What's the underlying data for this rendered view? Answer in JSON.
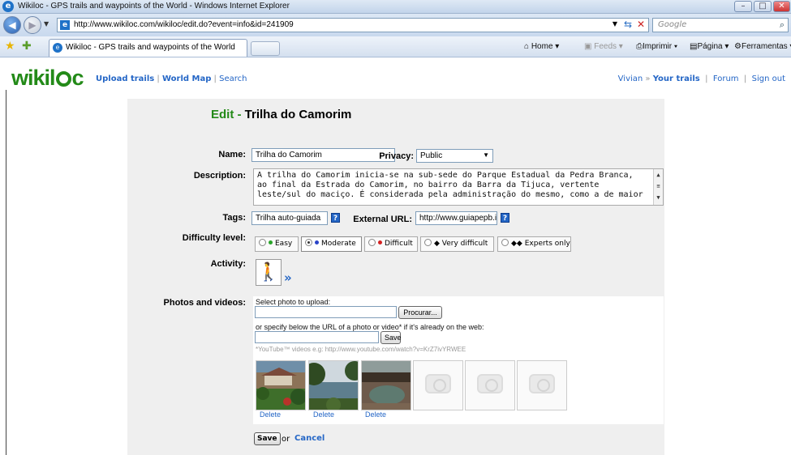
{
  "window": {
    "title": "Wikiloc - GPS trails and waypoints of the World - Windows Internet Explorer"
  },
  "address_bar": {
    "url": "http://www.wikiloc.com/wikiloc/edit.do?event=info&id=241909",
    "search_placeholder": "Google"
  },
  "tabs": [
    {
      "label": "Wikiloc - GPS trails and waypoints of the World"
    }
  ],
  "command_bar": {
    "home": "Home",
    "feeds": "Feeds",
    "print": "Imprimir",
    "page": "Página",
    "tools": "Ferramentas"
  },
  "site_header": {
    "logo": "wikiloc",
    "nav": [
      "Upload trails",
      "World Map",
      "Search"
    ],
    "user": "Vivian",
    "user_links": [
      "Your trails",
      "Forum",
      "Sign out"
    ]
  },
  "form": {
    "heading_prefix": "Edit -",
    "heading_title": "Trilha do Camorim",
    "name_label": "Name:",
    "name_value": "Trilha do Camorim",
    "privacy_label": "Privacy:",
    "privacy_value": "Public",
    "description_label": "Description:",
    "description_lines": [
      "A trilha do Camorim inicia-se na sub-sede do Parque Estadual da Pedra Branca,",
      "ao final da Estrada do Camorim, no bairro da Barra da Tijuca, vertente",
      "leste/sul do maciço. É considerada pela administração do mesmo, como a de maior"
    ],
    "tags_label": "Tags:",
    "tags_value": "Trilha auto-guiada",
    "external_url_label": "External URL:",
    "external_url_value": "http://www.guiapepb.ir",
    "help_glyph": "?",
    "difficulty_label": "Difficulty level:",
    "difficulty_options": [
      {
        "label": "Easy",
        "color": "#2aa52a",
        "selected": false
      },
      {
        "label": "Moderate",
        "color": "#2a44c8",
        "selected": true
      },
      {
        "label": "Difficult",
        "color": "#d42020",
        "selected": false
      },
      {
        "label": "Very difficult",
        "color": "#000000",
        "selected": false
      },
      {
        "label": "Experts only",
        "color": "#000000",
        "selected": false
      }
    ],
    "activity_label": "Activity:",
    "activity_icon": "hiking-icon",
    "activity_more": "»",
    "photos_label": "Photos and videos:",
    "select_photo_text": "Select photo to upload:",
    "browse_button": "Procurar...",
    "url_hint": "or specify below the URL of a photo or video* if it's already on the web:",
    "url_save_button": "Save",
    "youtube_note": "*YouTube™ videos e.g: http://www.youtube.com/watch?v=KrZ7ivYRWEE",
    "photos": [
      {
        "delete": "Delete",
        "scene": "house-garden"
      },
      {
        "delete": "Delete",
        "scene": "lake-trees"
      },
      {
        "delete": "Delete",
        "scene": "dark-water"
      },
      {
        "delete": "",
        "scene": "empty"
      },
      {
        "delete": "",
        "scene": "empty"
      },
      {
        "delete": "",
        "scene": "empty"
      }
    ],
    "save_button": "Save",
    "or_text": "or",
    "cancel_link": "Cancel"
  }
}
